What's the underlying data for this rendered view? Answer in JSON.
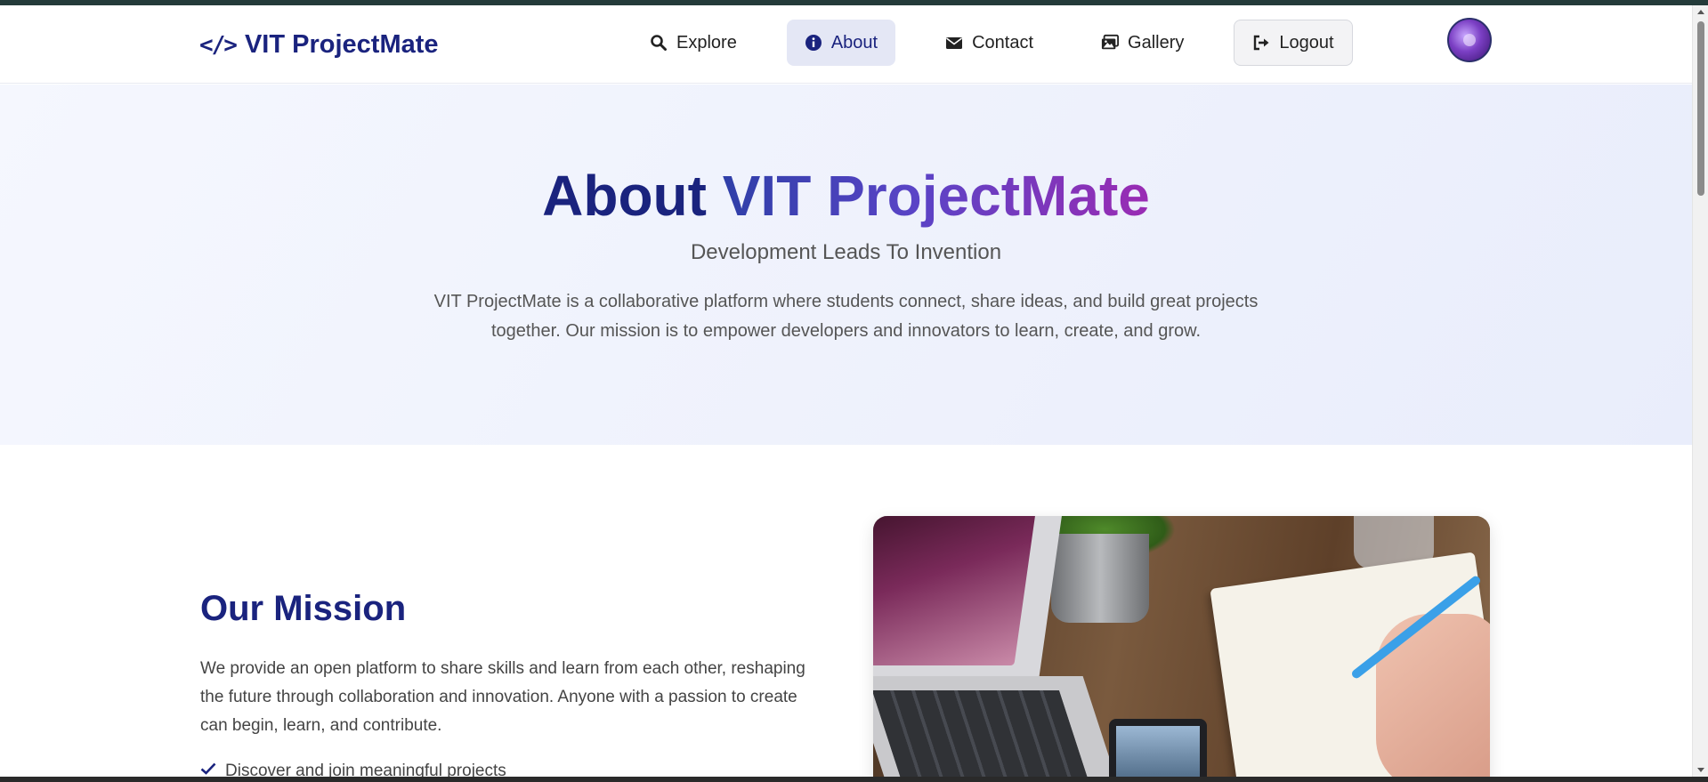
{
  "brand": {
    "name": "VIT ProjectMate",
    "icon": "code-icon"
  },
  "nav": {
    "items": [
      {
        "label": "Explore",
        "icon": "search-icon"
      },
      {
        "label": "About",
        "icon": "info-icon",
        "active": true
      },
      {
        "label": "Contact",
        "icon": "envelope-icon"
      },
      {
        "label": "Gallery",
        "icon": "images-icon"
      },
      {
        "label": "Logout",
        "icon": "logout-icon"
      }
    ]
  },
  "hero": {
    "title_part1": "About",
    "title_part2": "VIT ProjectMate",
    "subtitle": "Development Leads To Invention",
    "description": "VIT ProjectMate is a collaborative platform where students connect, share ideas, and build great projects together. Our mission is to empower developers and innovators to learn, create, and grow."
  },
  "mission": {
    "title": "Our Mission",
    "text": "We provide an open platform to share skills and learn from each other, reshaping the future through collaboration and innovation. Anyone with a passion to create can begin, learn, and contribute.",
    "list": [
      "Discover and join meaningful projects"
    ]
  },
  "colors": {
    "brand": "#1a237e",
    "active_nav_bg": "#e4e7f5",
    "gradient_start": "#2f3fa8",
    "gradient_end": "#9a2bb3"
  }
}
